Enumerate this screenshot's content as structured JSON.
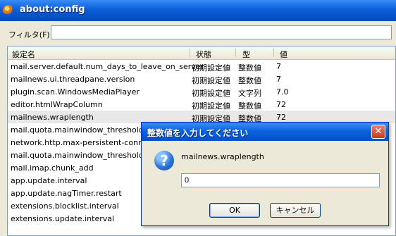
{
  "window": {
    "title": "about:config"
  },
  "filter": {
    "label": "フィルタ(F):",
    "value": ""
  },
  "columns": [
    "設定名",
    "状態",
    "型",
    "値"
  ],
  "rows": [
    {
      "name": "mail.server.default.num_days_to_leave_on_server",
      "status": "初期設定値",
      "type": "整数値",
      "value": "7"
    },
    {
      "name": "mailnews.ui.threadpane.version",
      "status": "初期設定値",
      "type": "整数値",
      "value": "7"
    },
    {
      "name": "plugin.scan.WindowsMediaPlayer",
      "status": "初期設定値",
      "type": "文字列",
      "value": "7.0"
    },
    {
      "name": "editor.htmlWrapColumn",
      "status": "初期設定値",
      "type": "整数値",
      "value": "72"
    },
    {
      "name": "mailnews.wraplength",
      "status": "初期設定値",
      "type": "整数値",
      "value": "72"
    },
    {
      "name": "mail.quota.mainwindow_threshold.show",
      "status": "",
      "type": "",
      "value": ""
    },
    {
      "name": "network.http.max-persistent-connect",
      "status": "",
      "type": "",
      "value": ""
    },
    {
      "name": "mail.quota.mainwindow_threshold.warn",
      "status": "",
      "type": "",
      "value": ""
    },
    {
      "name": "mail.imap.chunk_add",
      "status": "",
      "type": "",
      "value": ""
    },
    {
      "name": "app.update.interval",
      "status": "",
      "type": "",
      "value": ""
    },
    {
      "name": "app.update.nagTimer.restart",
      "status": "",
      "type": "",
      "value": ""
    },
    {
      "name": "extensions.blocklist.interval",
      "status": "",
      "type": "",
      "value": ""
    },
    {
      "name": "extensions.update.interval",
      "status": "",
      "type": "",
      "value": ""
    }
  ],
  "dialog": {
    "title": "整数値を入力してください",
    "close": "✕",
    "prompt": "mailnews.wraplength",
    "value": "0",
    "ok": "OK",
    "cancel": "キャンセル",
    "icon": "question-icon"
  }
}
